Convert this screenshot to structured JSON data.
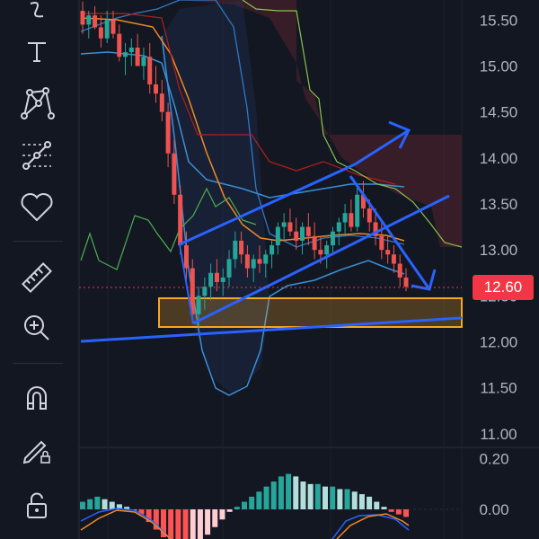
{
  "toolbar": {
    "items": [
      {
        "name": "curve-tool-icon"
      },
      {
        "name": "text-tool-icon"
      },
      {
        "name": "pattern-tool-icon"
      },
      {
        "name": "prediction-tool-icon"
      },
      {
        "name": "favorites-icon"
      },
      {
        "name": "ruler-icon"
      },
      {
        "name": "zoom-in-icon"
      },
      {
        "name": "magnet-icon"
      },
      {
        "name": "drawing-mode-icon"
      },
      {
        "name": "lock-icon"
      }
    ]
  },
  "price_axis": {
    "ticks": [
      "15.50",
      "15.00",
      "14.50",
      "14.00",
      "13.50",
      "13.00",
      "12.50",
      "12.00",
      "11.50",
      "11.00"
    ],
    "last_price": "12.60",
    "last_price_color": "#f23645"
  },
  "macd_axis": {
    "ticks": [
      "0.20",
      "0.00"
    ]
  },
  "colors": {
    "background": "#131722",
    "up": "#26a69a",
    "down": "#ef5350",
    "trendline": "#2962ff",
    "support_zone": "#f5a623"
  },
  "chart_data": {
    "type": "candlestick",
    "ylim": [
      10.95,
      15.62
    ],
    "candles": [
      [
        15.6,
        15.7,
        15.35,
        15.45
      ],
      [
        15.45,
        15.6,
        15.3,
        15.55
      ],
      [
        15.55,
        15.65,
        15.4,
        15.42
      ],
      [
        15.42,
        15.55,
        15.2,
        15.3
      ],
      [
        15.3,
        15.6,
        15.25,
        15.5
      ],
      [
        15.5,
        15.6,
        15.3,
        15.35
      ],
      [
        15.35,
        15.45,
        15.05,
        15.1
      ],
      [
        15.1,
        15.25,
        14.9,
        15.15
      ],
      [
        15.15,
        15.3,
        15.0,
        15.2
      ],
      [
        15.2,
        15.35,
        15.05,
        15.0
      ],
      [
        15.0,
        15.2,
        14.85,
        15.1
      ],
      [
        15.1,
        15.25,
        14.7,
        14.8
      ],
      [
        14.8,
        15.0,
        14.6,
        14.7
      ],
      [
        14.7,
        14.85,
        14.4,
        14.5
      ],
      [
        14.5,
        14.6,
        13.9,
        14.05
      ],
      [
        14.05,
        14.2,
        13.5,
        13.6
      ],
      [
        13.6,
        13.7,
        12.95,
        13.05
      ],
      [
        13.05,
        13.2,
        12.6,
        12.8
      ],
      [
        12.8,
        12.9,
        12.2,
        12.3
      ],
      [
        12.3,
        12.6,
        12.15,
        12.5
      ],
      [
        12.5,
        12.7,
        12.35,
        12.6
      ],
      [
        12.6,
        12.85,
        12.45,
        12.75
      ],
      [
        12.75,
        12.9,
        12.55,
        12.65
      ],
      [
        12.65,
        12.8,
        12.5,
        12.7
      ],
      [
        12.7,
        13.0,
        12.6,
        12.9
      ],
      [
        12.9,
        13.2,
        12.8,
        13.1
      ],
      [
        13.1,
        13.2,
        12.85,
        12.95
      ],
      [
        12.95,
        13.05,
        12.7,
        12.8
      ],
      [
        12.8,
        12.95,
        12.65,
        12.9
      ],
      [
        12.9,
        13.05,
        12.75,
        12.85
      ],
      [
        12.85,
        13.0,
        12.7,
        12.95
      ],
      [
        12.95,
        13.1,
        12.8,
        13.05
      ],
      [
        13.05,
        13.3,
        12.95,
        13.25
      ],
      [
        13.25,
        13.4,
        13.1,
        13.3
      ],
      [
        13.3,
        13.45,
        13.15,
        13.2
      ],
      [
        13.2,
        13.35,
        13.0,
        13.1
      ],
      [
        13.1,
        13.3,
        12.95,
        13.25
      ],
      [
        13.25,
        13.4,
        13.05,
        13.15
      ],
      [
        13.15,
        13.3,
        12.9,
        13.0
      ],
      [
        13.0,
        13.15,
        12.85,
        12.95
      ],
      [
        12.95,
        13.1,
        12.8,
        13.05
      ],
      [
        13.05,
        13.25,
        12.95,
        13.2
      ],
      [
        13.2,
        13.35,
        13.05,
        13.3
      ],
      [
        13.3,
        13.5,
        13.15,
        13.4
      ],
      [
        13.4,
        13.55,
        13.2,
        13.25
      ],
      [
        13.25,
        13.7,
        13.2,
        13.6
      ],
      [
        13.6,
        13.75,
        13.35,
        13.45
      ],
      [
        13.45,
        13.55,
        13.2,
        13.3
      ],
      [
        13.3,
        13.45,
        13.05,
        13.15
      ],
      [
        13.15,
        13.3,
        12.9,
        13.0
      ],
      [
        13.0,
        13.15,
        12.85,
        12.95
      ],
      [
        12.95,
        13.05,
        12.75,
        12.85
      ],
      [
        12.85,
        12.95,
        12.6,
        12.7
      ],
      [
        12.7,
        12.8,
        12.55,
        12.6
      ]
    ],
    "last_price": 12.6,
    "support_zone": [
      12.17,
      12.47
    ],
    "macd_histogram": [
      0.03,
      0.04,
      0.05,
      0.04,
      0.03,
      0.02,
      0.01,
      0.0,
      -0.02,
      -0.05,
      -0.08,
      -0.11,
      -0.14,
      -0.16,
      -0.16,
      -0.15,
      -0.13,
      -0.1,
      -0.07,
      -0.04,
      -0.01,
      0.01,
      0.03,
      0.05,
      0.07,
      0.09,
      0.11,
      0.13,
      0.14,
      0.13,
      0.11,
      0.1,
      0.1,
      0.09,
      0.09,
      0.08,
      0.08,
      0.07,
      0.06,
      0.05,
      0.03,
      0.01,
      -0.01,
      -0.02,
      -0.03
    ],
    "macd_ylim": [
      -0.05,
      0.22
    ]
  }
}
